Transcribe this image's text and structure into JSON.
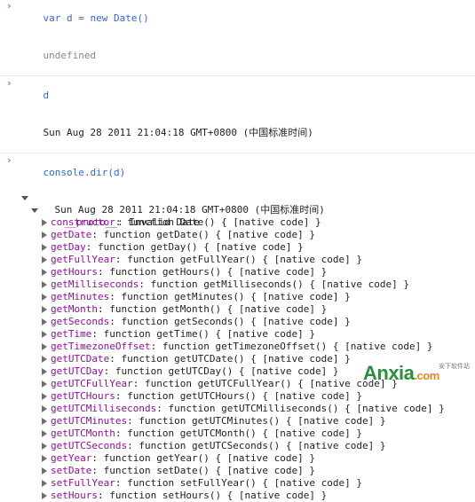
{
  "console": {
    "line1_input": "var d = new Date()",
    "line1_result": "undefined",
    "line2_input": "d",
    "line2_result": "Sun Aug 28 2011 21:04:18 GMT+0800 (中国标准时间)",
    "line3_input": "console.dir(d)",
    "dir_root_label": "Sun Aug 28 2011 21:04:18 GMT+0800 (中国标准时间)",
    "proto_key": "__proto__",
    "proto_value": "Invalid Date",
    "members": [
      {
        "key": "constructor",
        "value": "function Date() { [native code] }"
      },
      {
        "key": "getDate",
        "value": "function getDate() { [native code] }"
      },
      {
        "key": "getDay",
        "value": "function getDay() { [native code] }"
      },
      {
        "key": "getFullYear",
        "value": "function getFullYear() { [native code] }"
      },
      {
        "key": "getHours",
        "value": "function getHours() { [native code] }"
      },
      {
        "key": "getMilliseconds",
        "value": "function getMilliseconds() { [native code] }"
      },
      {
        "key": "getMinutes",
        "value": "function getMinutes() { [native code] }"
      },
      {
        "key": "getMonth",
        "value": "function getMonth() { [native code] }"
      },
      {
        "key": "getSeconds",
        "value": "function getSeconds() { [native code] }"
      },
      {
        "key": "getTime",
        "value": "function getTime() { [native code] }"
      },
      {
        "key": "getTimezoneOffset",
        "value": "function getTimezoneOffset() { [native code] }"
      },
      {
        "key": "getUTCDate",
        "value": "function getUTCDate() { [native code] }"
      },
      {
        "key": "getUTCDay",
        "value": "function getUTCDay() { [native code] }"
      },
      {
        "key": "getUTCFullYear",
        "value": "function getUTCFullYear() { [native code] }"
      },
      {
        "key": "getUTCHours",
        "value": "function getUTCHours() { [native code] }"
      },
      {
        "key": "getUTCMilliseconds",
        "value": "function getUTCMilliseconds() { [native code] }"
      },
      {
        "key": "getUTCMinutes",
        "value": "function getUTCMinutes() { [native code] }"
      },
      {
        "key": "getUTCMonth",
        "value": "function getUTCMonth() { [native code] }"
      },
      {
        "key": "getUTCSeconds",
        "value": "function getUTCSeconds() { [native code] }"
      },
      {
        "key": "getYear",
        "value": "function getYear() { [native code] }"
      },
      {
        "key": "setDate",
        "value": "function setDate() { [native code] }"
      },
      {
        "key": "setFullYear",
        "value": "function setFullYear() { [native code] }"
      },
      {
        "key": "setHours",
        "value": "function setHours() { [native code] }"
      }
    ]
  },
  "watermark": {
    "logo_text": "Anxia",
    "logo_suffix": ".com",
    "sub_text": "安下软件站"
  },
  "colors": {
    "prompt": "#3367d6",
    "property_key": "#881391",
    "muted": "#888888"
  }
}
